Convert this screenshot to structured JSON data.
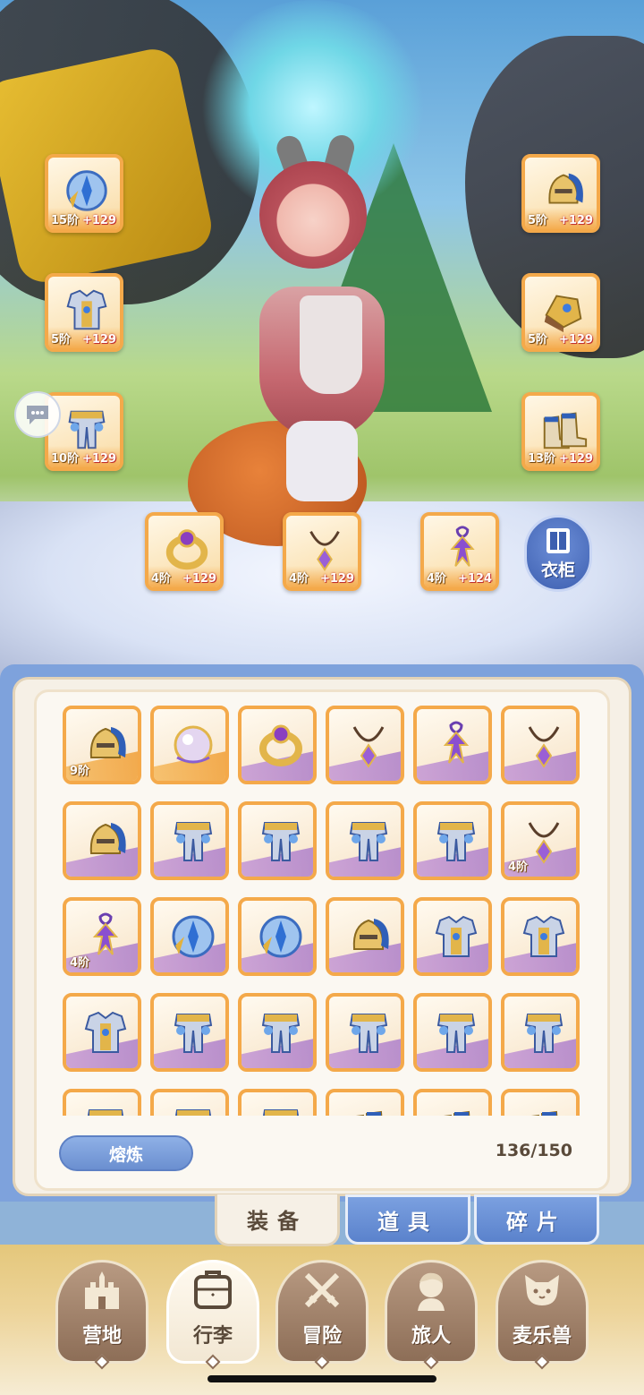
{
  "equipped": {
    "left": [
      {
        "name": "helmet-orb",
        "tier": "15阶",
        "plus": "+129"
      },
      {
        "name": "armor",
        "tier": "5阶",
        "plus": "+129"
      },
      {
        "name": "leg-armor",
        "tier": "10阶",
        "plus": "+129"
      }
    ],
    "right": [
      {
        "name": "winged-helmet",
        "tier": "5阶",
        "plus": "+129"
      },
      {
        "name": "gauntlet",
        "tier": "5阶",
        "plus": "+129"
      },
      {
        "name": "boots",
        "tier": "13阶",
        "plus": "+129"
      }
    ],
    "bottom": [
      {
        "name": "ring",
        "tier": "4阶",
        "plus": "+129"
      },
      {
        "name": "necklace",
        "tier": "4阶",
        "plus": "+129"
      },
      {
        "name": "amulet",
        "tier": "4阶",
        "plus": "+124"
      }
    ]
  },
  "wardrobe": {
    "label": "衣柜",
    "icon": "wardrobe-icon"
  },
  "chat": {
    "icon": "chat-bubble-icon"
  },
  "inventory": {
    "rows": [
      [
        {
          "item": "winged-helmet",
          "color": "gold",
          "tier": "9阶"
        },
        {
          "item": "pearl-orb",
          "color": "gold",
          "tier": ""
        },
        {
          "item": "ring",
          "color": "purple",
          "tier": ""
        },
        {
          "item": "necklace",
          "color": "purple",
          "tier": ""
        },
        {
          "item": "amulet",
          "color": "purple",
          "tier": ""
        },
        {
          "item": "necklace",
          "color": "purple",
          "tier": ""
        }
      ],
      [
        {
          "item": "winged-helmet",
          "color": "purple",
          "tier": ""
        },
        {
          "item": "leg-armor",
          "color": "purple",
          "tier": ""
        },
        {
          "item": "leg-armor",
          "color": "purple",
          "tier": ""
        },
        {
          "item": "leg-armor",
          "color": "purple",
          "tier": ""
        },
        {
          "item": "leg-armor",
          "color": "purple",
          "tier": ""
        },
        {
          "item": "necklace",
          "color": "purple",
          "tier": "4阶"
        }
      ],
      [
        {
          "item": "amulet",
          "color": "purple",
          "tier": "4阶"
        },
        {
          "item": "helmet-orb",
          "color": "purple",
          "tier": ""
        },
        {
          "item": "helmet-orb",
          "color": "purple",
          "tier": ""
        },
        {
          "item": "winged-helmet",
          "color": "purple",
          "tier": ""
        },
        {
          "item": "armor",
          "color": "purple",
          "tier": ""
        },
        {
          "item": "armor",
          "color": "purple",
          "tier": ""
        }
      ],
      [
        {
          "item": "armor",
          "color": "purple",
          "tier": ""
        },
        {
          "item": "leg-armor",
          "color": "purple",
          "tier": ""
        },
        {
          "item": "leg-armor",
          "color": "purple",
          "tier": ""
        },
        {
          "item": "leg-armor",
          "color": "purple",
          "tier": ""
        },
        {
          "item": "leg-armor",
          "color": "purple",
          "tier": ""
        },
        {
          "item": "leg-armor",
          "color": "purple",
          "tier": ""
        }
      ],
      [
        {
          "item": "leg-armor",
          "color": "purple",
          "tier": ""
        },
        {
          "item": "leg-armor",
          "color": "purple",
          "tier": ""
        },
        {
          "item": "leg-armor",
          "color": "purple",
          "tier": ""
        },
        {
          "item": "boots",
          "color": "purple",
          "tier": ""
        },
        {
          "item": "boots",
          "color": "purple",
          "tier": ""
        },
        {
          "item": "boots",
          "color": "purple",
          "tier": ""
        }
      ]
    ],
    "smelt_label": "熔炼",
    "capacity": "136/150"
  },
  "tabs": [
    {
      "label": "装备",
      "active": true
    },
    {
      "label": "道具",
      "active": false
    },
    {
      "label": "碎片",
      "active": false
    }
  ],
  "nav": [
    {
      "label": "营地",
      "icon": "castle-icon",
      "active": false
    },
    {
      "label": "行李",
      "icon": "luggage-icon",
      "active": true
    },
    {
      "label": "冒险",
      "icon": "crossed-swords-icon",
      "active": false
    },
    {
      "label": "旅人",
      "icon": "traveler-icon",
      "active": false
    },
    {
      "label": "麦乐兽",
      "icon": "cat-icon",
      "active": false
    }
  ],
  "colors": {
    "slot_border": "#f4a94a",
    "panel_blue": "#7ea2dc",
    "purple_band": "#a678c8"
  }
}
